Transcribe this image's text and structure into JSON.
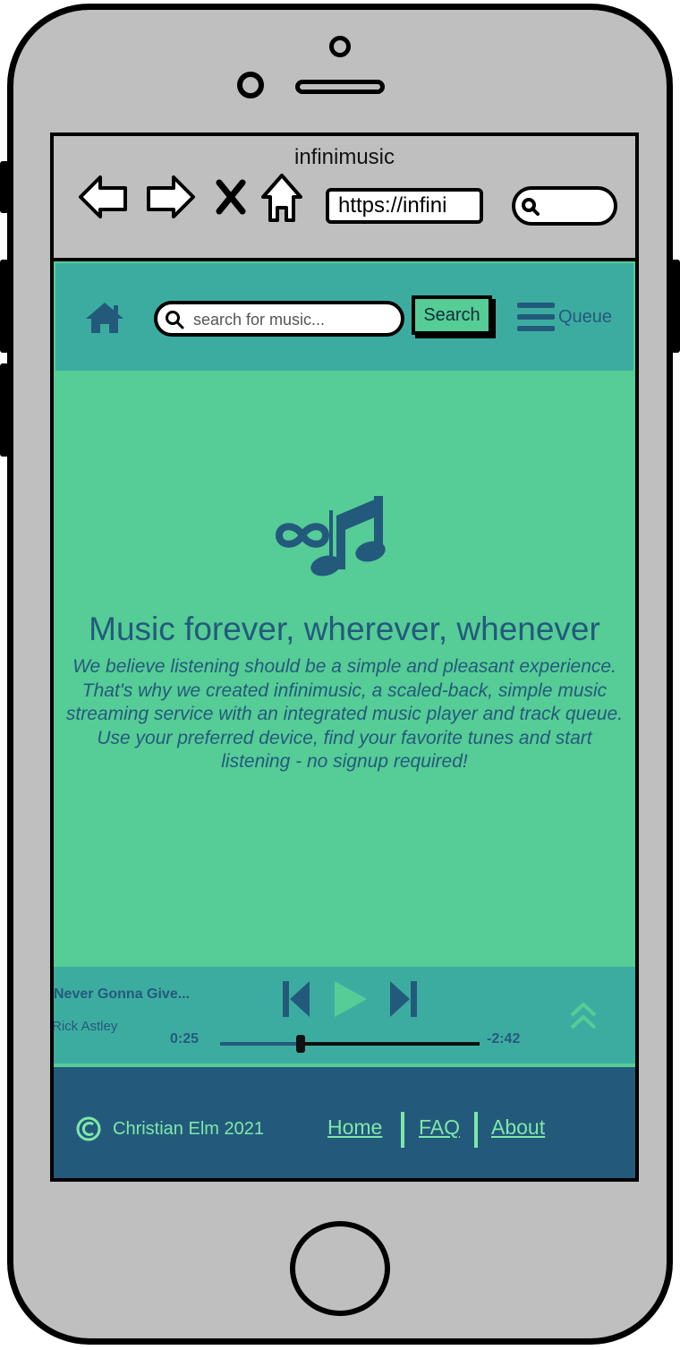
{
  "browser": {
    "title": "infinimusic",
    "url": "https://infini",
    "icons": [
      "back-arrow-icon",
      "forward-arrow-icon",
      "close-icon",
      "home-icon",
      "search-icon"
    ]
  },
  "header": {
    "search_placeholder": "search for music...",
    "search_button": "Search",
    "queue_label": "Queue",
    "icons": [
      "home-icon",
      "search-icon",
      "hamburger-menu-icon"
    ]
  },
  "hero": {
    "logo_icon": "infinity-music-note-icon",
    "title": "Music forever, wherever, whenever",
    "text": "We believe listening should be a simple and pleasant experience. That's why we created infinimusic, a scaled-back, simple music streaming service with an integrated music player and track queue. Use your preferred device, find your favorite tunes and start listening - no signup required!"
  },
  "player": {
    "track_title": "Never Gonna Give...",
    "artist": "Rick Astley",
    "elapsed": "0:25",
    "remaining": "-2:42",
    "progress": 0.31,
    "icons": [
      "skip-back-icon",
      "play-icon",
      "skip-forward-icon",
      "expand-up-icon"
    ]
  },
  "footer": {
    "copyright": "Christian Elm 2021",
    "links": [
      "Home",
      "FAQ",
      "About"
    ]
  },
  "colors": {
    "page_bg": "#56cc96",
    "header_bg": "#3daca0",
    "primary_text": "#235a7c",
    "footer_bg": "#235a7c",
    "footer_text": "#7ee8a8",
    "device": "#bfbfbf"
  }
}
